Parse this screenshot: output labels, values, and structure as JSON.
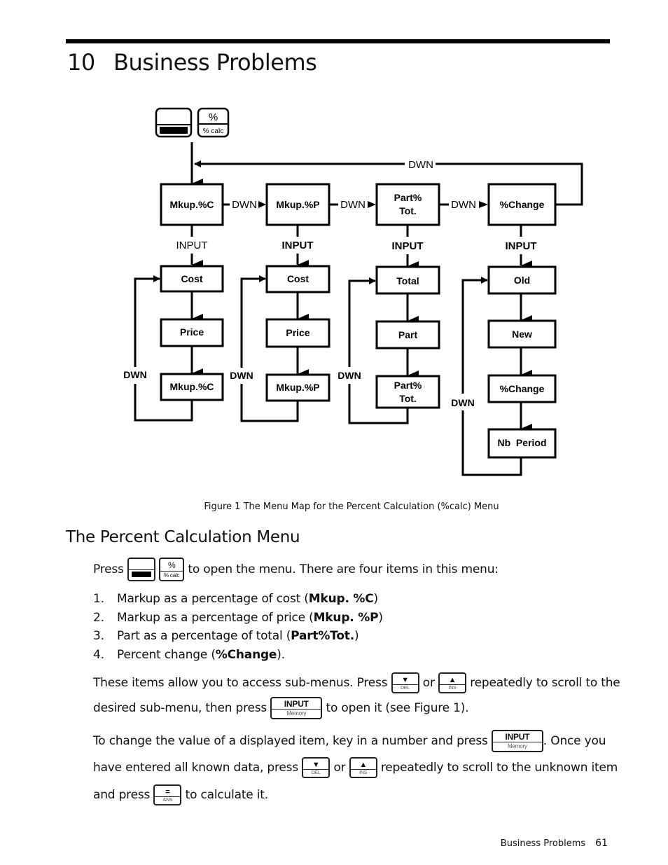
{
  "chapter": {
    "number": "10",
    "title": "Business Problems"
  },
  "figure": {
    "keys": {
      "shift": {
        "name": "shift-key"
      },
      "pct": {
        "top": "%",
        "bottom": "% calc"
      }
    },
    "loop_label": "DWN",
    "top_items": [
      {
        "label": "Mkup.%C",
        "input_label": "INPUT"
      },
      {
        "label": "Mkup.%P",
        "input_label": "INPUT"
      },
      {
        "label_line1": "Part%",
        "label_line2": "Tot.",
        "input_label": "INPUT"
      },
      {
        "label": "%Change",
        "input_label": "INPUT"
      }
    ],
    "between_label": "DWN",
    "submenus": [
      {
        "items": [
          "Cost",
          "Price",
          "Mkup.%C"
        ],
        "loop_label": "DWN"
      },
      {
        "items": [
          "Cost",
          "Price",
          "Mkup.%P"
        ],
        "loop_label": "DWN"
      },
      {
        "items": [
          "Total",
          "Part",
          "Part%",
          "Tot."
        ],
        "loop_label": "DWN"
      },
      {
        "items": [
          "Old",
          "New",
          "%Change",
          "Nb  Period"
        ],
        "loop_label": "DWN"
      }
    ],
    "caption": "Figure 1  The Menu Map for the Percent Calculation (%calc) Menu"
  },
  "section": {
    "title": "The Percent Calculation Menu",
    "intro_press": "Press",
    "intro_rest": "to open the menu. There are four items in this menu:",
    "list": [
      {
        "num": "1.",
        "text": "Markup as a percentage of cost (",
        "bold": "Mkup. %C",
        "after": ")"
      },
      {
        "num": "2.",
        "text": "Markup as a percentage of price (",
        "bold": "Mkup. %P",
        "after": ")"
      },
      {
        "num": "3.",
        "text": "Part as a percentage of total (",
        "bold": "Part%Tot.",
        "after": ")"
      },
      {
        "num": "4.",
        "text": "Percent change (",
        "bold": "%Change",
        "after": ")."
      }
    ],
    "para2": {
      "a": "These items allow you to access sub-menus. Press",
      "or": "or",
      "b": "repeatedly to scroll to the",
      "c": "desired sub-menu, then press",
      "d": "to open it (see Figure 1)."
    },
    "para3": {
      "a": "To change the value of a displayed item, key in a number and press",
      "b": ". Once you",
      "c": "have entered all known data, press",
      "or": "or",
      "d": "repeatedly to scroll to the unknown item",
      "e": "and press",
      "f": "to calculate it."
    },
    "keys": {
      "down": {
        "top": "▼",
        "bottom": "DEL"
      },
      "up": {
        "top": "▲",
        "bottom": "INS"
      },
      "input": {
        "top": "INPUT",
        "bottom": "Memory"
      },
      "equals": {
        "top": "=",
        "bottom": "ANS"
      }
    }
  },
  "footer": {
    "section": "Business Problems",
    "page": "61"
  }
}
